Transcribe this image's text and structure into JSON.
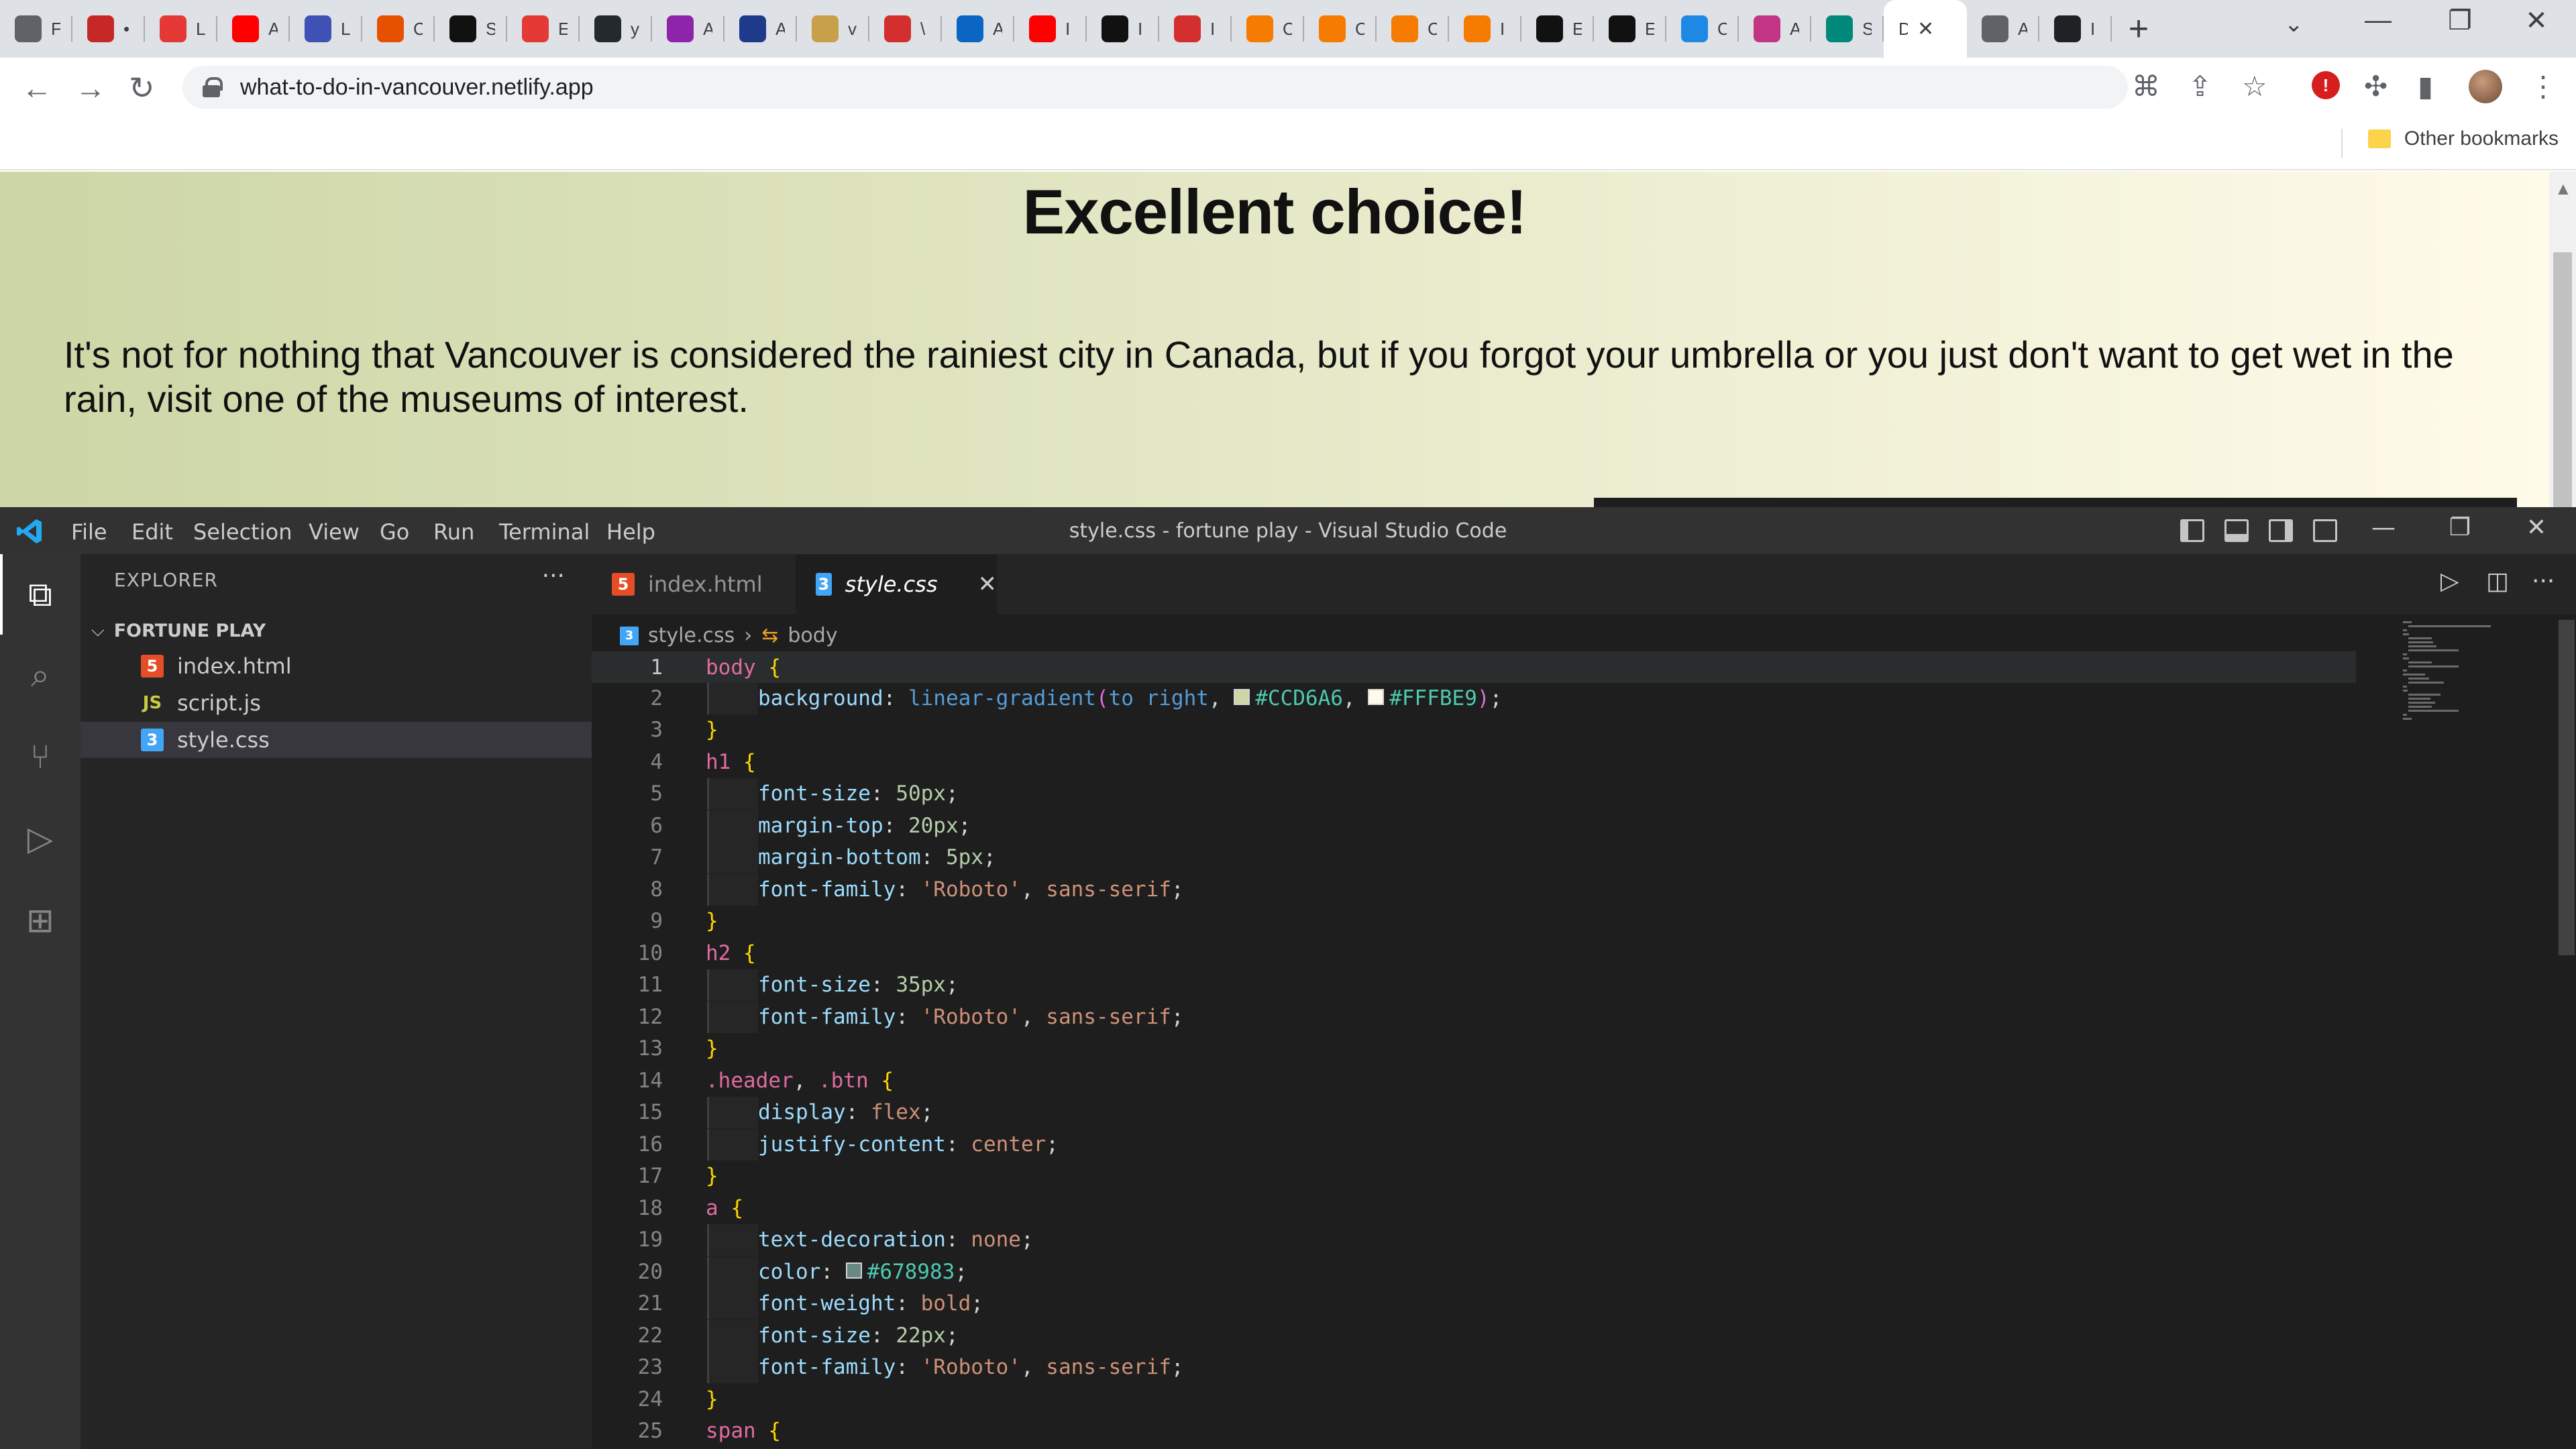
{
  "browser": {
    "tabs": [
      {
        "icon": "globe-icon",
        "letter": "F",
        "color": "#5f6368"
      },
      {
        "icon": "red-s-icon",
        "letter": "•",
        "color": "#c62828"
      },
      {
        "icon": "red-figure-icon",
        "letter": "L",
        "color": "#e53935"
      },
      {
        "icon": "youtube-icon",
        "letter": "A",
        "color": "#ff0000"
      },
      {
        "icon": "blue-app-icon",
        "letter": "L",
        "color": "#3f51b5"
      },
      {
        "icon": "hand-icon",
        "letter": "C",
        "color": "#e65100"
      },
      {
        "icon": "m-icon",
        "letter": "S",
        "color": "#111111"
      },
      {
        "icon": "red-figure-icon",
        "letter": "E",
        "color": "#e53935"
      },
      {
        "icon": "github-icon",
        "letter": "y",
        "color": "#24292e"
      },
      {
        "icon": "flower-icon",
        "letter": "A",
        "color": "#8e24aa"
      },
      {
        "icon": "s-circle-icon",
        "letter": "A",
        "color": "#1e3a8a"
      },
      {
        "icon": "doge-icon",
        "letter": "v",
        "color": "#c9a04a"
      },
      {
        "icon": "v-icon",
        "letter": "\\",
        "color": "#d32f2f"
      },
      {
        "icon": "linkedin-icon",
        "letter": "A",
        "color": "#0a66c2"
      },
      {
        "icon": "youtube-icon",
        "letter": "I",
        "color": "#ff0000"
      },
      {
        "icon": "music-icon",
        "letter": "I",
        "color": "#111111"
      },
      {
        "icon": "gmail-icon",
        "letter": "I",
        "color": "#d32f2f"
      },
      {
        "icon": "e-icon",
        "letter": "C",
        "color": "#f57c00"
      },
      {
        "icon": "e-icon",
        "letter": "C",
        "color": "#f57c00"
      },
      {
        "icon": "e-icon",
        "letter": "C",
        "color": "#f57c00"
      },
      {
        "icon": "e-icon",
        "letter": "I",
        "color": "#f57c00"
      },
      {
        "icon": "a-letter-icon",
        "letter": "E",
        "color": "#111111"
      },
      {
        "icon": "a-letter-icon",
        "letter": "E",
        "color": "#111111"
      },
      {
        "icon": "earth-icon",
        "letter": "C",
        "color": "#1e88e5"
      },
      {
        "icon": "instagram-icon",
        "letter": "A",
        "color": "#c13584"
      },
      {
        "icon": "diamond-icon",
        "letter": "S",
        "color": "#00897b"
      },
      {
        "icon": "d-icon",
        "letter": "D",
        "color": "#ffffff",
        "active": true
      },
      {
        "icon": "globe-icon",
        "letter": "A",
        "color": "#5f6368"
      },
      {
        "icon": "book-icon",
        "letter": "I",
        "color": "#202124"
      }
    ],
    "url": "what-to-do-in-vancouver.netlify.app",
    "other_bookmarks": "Other bookmarks"
  },
  "page": {
    "title": "Excellent choice!",
    "text": "It's not for nothing that Vancouver is considered the rainiest city in Canada, but if you forgot your umbrella or you just don't want to get wet in the rain, visit one of the museums of interest.",
    "gradient": [
      "#CCD6A6",
      "#FFFBE9"
    ]
  },
  "vscode": {
    "menu": [
      "File",
      "Edit",
      "Selection",
      "View",
      "Go",
      "Run",
      "Terminal",
      "Help"
    ],
    "title": "style.css - fortune play - Visual Studio Code",
    "explorer_label": "EXPLORER",
    "folder": "FORTUNE PLAY",
    "files": [
      {
        "name": "index.html",
        "type": "html",
        "icon_text": "5"
      },
      {
        "name": "script.js",
        "type": "js",
        "icon_text": "JS"
      },
      {
        "name": "style.css",
        "type": "css",
        "icon_text": "3",
        "selected": true
      }
    ],
    "tabs": [
      {
        "name": "index.html",
        "type": "html",
        "icon_text": "5"
      },
      {
        "name": "style.css",
        "type": "css",
        "icon_text": "3",
        "active": true
      }
    ],
    "breadcrumb": {
      "file": "style.css",
      "symbol": "body"
    },
    "code_lines": [
      "body {",
      "    background: linear-gradient(to right, #CCD6A6, #FFFBE9);",
      "}",
      "h1 {",
      "    font-size: 50px;",
      "    margin-top: 20px;",
      "    margin-bottom: 5px;",
      "    font-family: 'Roboto', sans-serif;",
      "}",
      "h2 {",
      "    font-size: 35px;",
      "    font-family: 'Roboto', sans-serif;",
      "}",
      ".header, .btn {",
      "    display: flex;",
      "    justify-content: center;",
      "}",
      "a {",
      "    text-decoration: none;",
      "    color: #678983;",
      "    font-weight: bold;",
      "    font-size: 22px;",
      "    font-family: 'Roboto', sans-serif;",
      "}",
      "span {"
    ],
    "cursor_line": 1,
    "swatch_colors": {
      "CCD6A6": "#CCD6A6",
      "FFFBE9": "#FFFBE9",
      "678983": "#678983"
    }
  }
}
